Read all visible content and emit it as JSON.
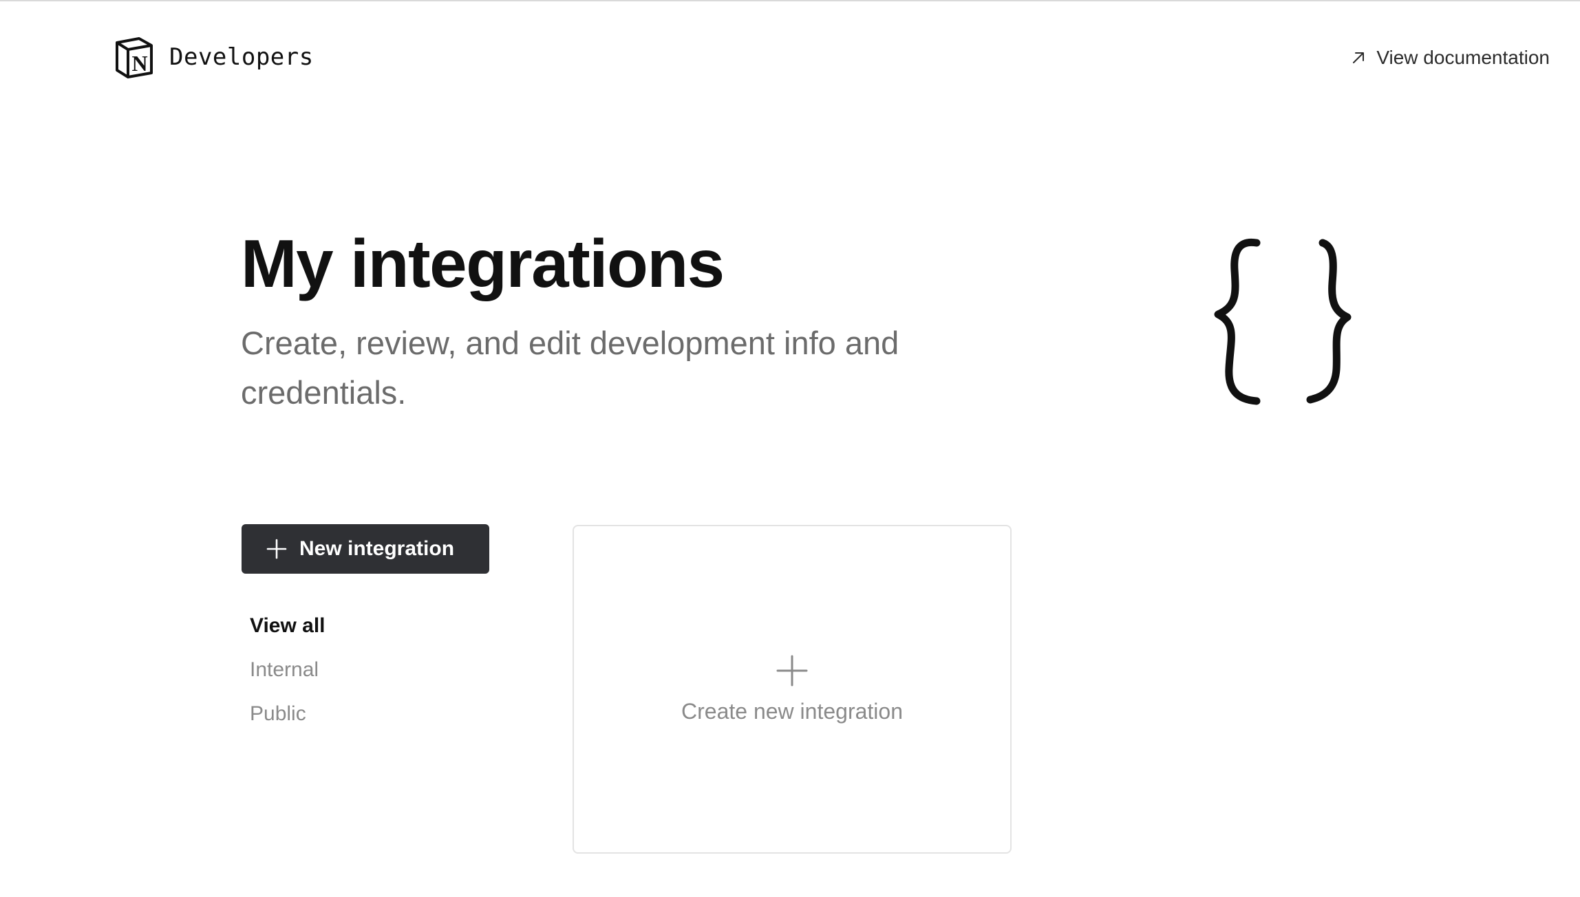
{
  "header": {
    "brand_name": "Developers",
    "docs_link_label": "View documentation"
  },
  "hero": {
    "title": "My integrations",
    "subtitle": "Create, review, and edit development info and credentials."
  },
  "sidebar": {
    "new_button_label": "New integration",
    "filters": [
      {
        "label": "View all",
        "active": true
      },
      {
        "label": "Internal",
        "active": false
      },
      {
        "label": "Public",
        "active": false
      }
    ]
  },
  "card": {
    "label": "Create new integration"
  },
  "icons": {
    "logo": "notion-logo-icon",
    "docs": "arrow-up-right-icon",
    "new": "plus-icon",
    "card": "plus-icon",
    "hero": "curly-braces-illustration"
  },
  "colors": {
    "button_bg": "#2f3034",
    "muted_text": "#8a8a8a",
    "subtitle_text": "#6b6b6b",
    "card_border": "#e3e3e3"
  }
}
